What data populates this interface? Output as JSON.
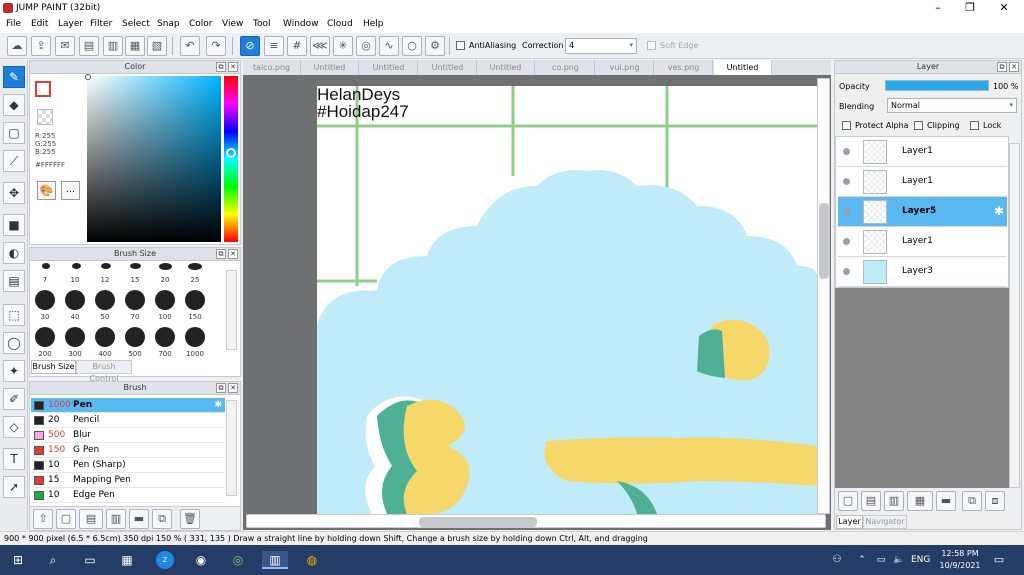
{
  "app": {
    "title": "JUMP PAINT (32bit)"
  },
  "window_controls": {
    "minimize": "–",
    "maximize": "❐",
    "close": "✕"
  },
  "menu": [
    "File",
    "Edit",
    "Layer",
    "Filter",
    "Select",
    "Snap",
    "Color",
    "View",
    "Tool",
    "Window",
    "Cloud",
    "Help"
  ],
  "toolbar": {
    "antialiasing_label": "AntiAliasing",
    "correction_label": "Correction",
    "correction_value": "4",
    "soft_edge_label": "Soft Edge"
  },
  "color_panel": {
    "title": "Color",
    "r": "R:255",
    "g": "G:255",
    "b": "B:255",
    "hex": "#FFFFFF"
  },
  "brush_size_panel": {
    "title": "Brush Size",
    "row1": [
      "7",
      "10",
      "12",
      "15",
      "20",
      "25"
    ],
    "row2": [
      "30",
      "40",
      "50",
      "70",
      "100",
      "150"
    ],
    "row3": [
      "200",
      "300",
      "400",
      "500",
      "700",
      "1000"
    ],
    "tab_brush_size": "Brush Size",
    "tab_brush_control": "Brush Control"
  },
  "brush_panel": {
    "title": "Brush",
    "items": [
      {
        "size": "1000",
        "name": "Pen",
        "color": "#222222"
      },
      {
        "size": "20",
        "name": "Pencil",
        "color": "#222222"
      },
      {
        "size": "500",
        "name": "Blur",
        "color": "#f7a8e8"
      },
      {
        "size": "150",
        "name": "G Pen",
        "color": "#e53935"
      },
      {
        "size": "10",
        "name": "Pen (Sharp)",
        "color": "#222222"
      },
      {
        "size": "15",
        "name": "Mapping Pen",
        "color": "#e53935"
      },
      {
        "size": "10",
        "name": "Edge Pen",
        "color": "#1fa84a"
      }
    ]
  },
  "tabs": [
    "taico.png",
    "Untitled",
    "Untitled",
    "Untitled",
    "Untitled",
    "co.png",
    "vui.png",
    "ves.png",
    "Untitled"
  ],
  "canvas": {
    "watermark_line1": "HelanDeys",
    "watermark_line2": "#Hoidap247"
  },
  "layer_panel": {
    "title": "Layer",
    "opacity_label": "Opacity",
    "opacity_value": "100 %",
    "opacity_percent": 100,
    "blending_label": "Blending",
    "blending_value": "Normal",
    "protect_alpha": "Protect Alpha",
    "clipping": "Clipping",
    "lock": "Lock",
    "layers": [
      "Layer1",
      "Layer1",
      "Layer5",
      "Layer1",
      "Layer3"
    ],
    "tab_layer": "Layer",
    "tab_navigator": "Navigator"
  },
  "status": {
    "text": "900 * 900 pixel   (6.5 * 6.5cm)   350 dpi   150 %   ( 331, 135 )   Draw a straight line by holding down Shift, Change a brush size by holding down Ctrl, Alt, and dragging"
  },
  "taskbar": {
    "lang": "ENG",
    "time": "12:58 PM",
    "date": "10/9/2021"
  },
  "colors": {
    "accent": "#1e7fd8",
    "selected_row": "#59b9f0",
    "sky": "#c0ebf8",
    "yellow": "#f5d76a",
    "teal": "#4fb095",
    "grid": "#8fcf8a"
  }
}
